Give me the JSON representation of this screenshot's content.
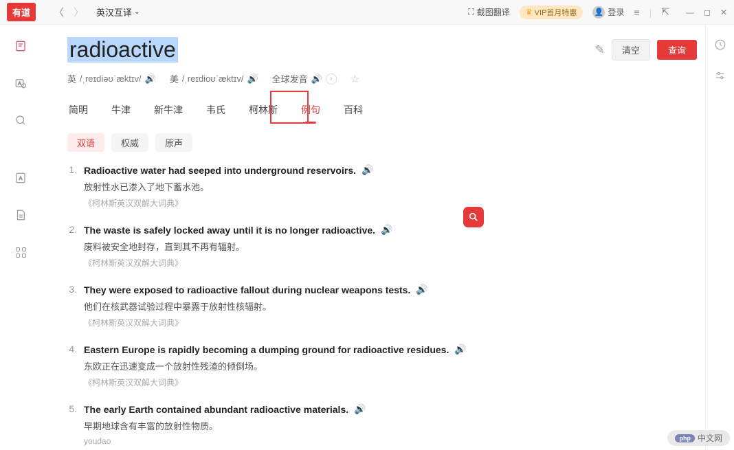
{
  "titlebar": {
    "logo": "有道",
    "dict_selector": "英汉互译",
    "screenshot": "截图翻译",
    "vip": "VIP首月特惠",
    "login": "登录"
  },
  "search": {
    "word": "radioactive",
    "clear_label": "清空",
    "query_label": "查询"
  },
  "pronunciation": {
    "uk_label": "英",
    "uk_ipa": "/ˌreɪdiəʊˈæktɪv/",
    "us_label": "美",
    "us_ipa": "/ˌreɪdioʊˈæktɪv/",
    "global": "全球发音"
  },
  "tabs": [
    "简明",
    "牛津",
    "新牛津",
    "韦氏",
    "柯林斯",
    "例句",
    "百科"
  ],
  "active_tab_index": 5,
  "filters": [
    "双语",
    "权威",
    "原声"
  ],
  "active_filter_index": 0,
  "examples": [
    {
      "num": "1.",
      "en": "Radioactive water had seeped into underground reservoirs.",
      "zh": "放射性水已渗入了地下蓄水池。",
      "src": "《柯林斯英汉双解大词典》"
    },
    {
      "num": "2.",
      "en": "The waste is safely locked away until it is no longer radioactive.",
      "zh": "废料被安全地封存，直到其不再有辐射。",
      "src": "《柯林斯英汉双解大词典》"
    },
    {
      "num": "3.",
      "en": "They were exposed to radioactive fallout during nuclear weapons tests.",
      "zh": "他们在核武器试验过程中暴露于放射性核辐射。",
      "src": "《柯林斯英汉双解大词典》"
    },
    {
      "num": "4.",
      "en": "Eastern Europe is rapidly becoming a dumping ground for radioactive residues.",
      "zh": "东欧正在迅速变成一个放射性残渣的倾倒场。",
      "src": "《柯林斯英汉双解大词典》"
    },
    {
      "num": "5.",
      "en": "The early Earth contained abundant radioactive materials.",
      "zh": "早期地球含有丰富的放射性物质。",
      "src": "youdao"
    }
  ],
  "bottom_badge": "中文网"
}
